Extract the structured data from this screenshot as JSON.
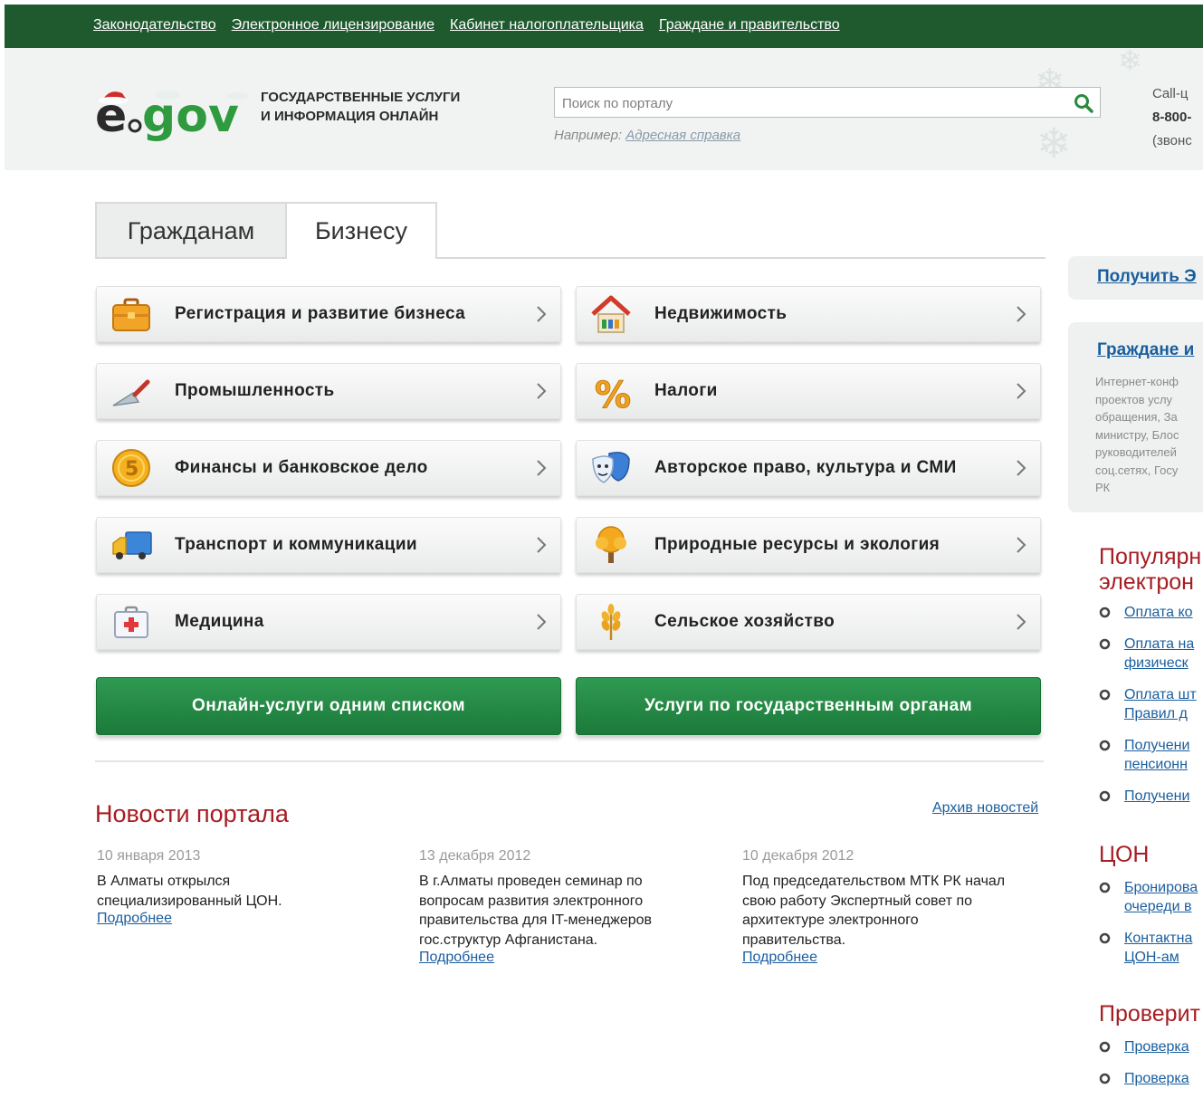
{
  "topnav": {
    "links": [
      "Законодательство",
      "Электронное лицензирование",
      "Кабинет налогоплательщика",
      "Граждане и правительство"
    ]
  },
  "header": {
    "logo_text": "egov",
    "tagline_line1": "ГОСУДАРСТВЕННЫЕ УСЛУГИ",
    "tagline_line2": "И ИНФОРМАЦИЯ ОНЛАЙН",
    "search_placeholder": "Поиск по порталу",
    "example_prefix": "Например:",
    "example_link": "Адресная справка",
    "callcenter_label": "Call-ц",
    "callcenter_phone": "8-800-",
    "callcenter_note": "(звонс"
  },
  "tabs": [
    "Гражданам",
    "Бизнесу"
  ],
  "categories": [
    {
      "label": "Регистрация и развитие бизнеса",
      "icon": "briefcase-icon"
    },
    {
      "label": "Недвижимость",
      "icon": "house-icon"
    },
    {
      "label": "Промышленность",
      "icon": "trowel-icon"
    },
    {
      "label": "Налоги",
      "icon": "percent-icon"
    },
    {
      "label": "Финансы и банковское дело",
      "icon": "coin-icon"
    },
    {
      "label": "Авторское право, культура и СМИ",
      "icon": "theater-masks-icon"
    },
    {
      "label": "Транспорт и коммуникации",
      "icon": "truck-icon"
    },
    {
      "label": "Природные ресурсы и экология",
      "icon": "tree-icon"
    },
    {
      "label": "Медицина",
      "icon": "first-aid-kit-icon"
    },
    {
      "label": "Сельское хозяйство",
      "icon": "wheat-icon"
    }
  ],
  "buttons": {
    "online_list": "Онлайн-услуги одним списком",
    "by_agencies": "Услуги по государственным органам"
  },
  "news": {
    "title": "Новости портала",
    "archive": "Архив новостей",
    "more": "Подробнее",
    "items": [
      {
        "date": "10 января 2013",
        "lines": [
          "В Алматы открылся",
          "специализированный ЦОН."
        ]
      },
      {
        "date": "13 декабря 2012",
        "lines": [
          "В г.Алматы проведен семинар по",
          "вопросам развития электронного",
          "правительства для IT-менеджеров",
          "гос.структур Афганистана."
        ]
      },
      {
        "date": "10 декабря 2012",
        "lines": [
          "Под председательством МТК РК начал",
          "свою работу Экспертный совет по",
          "архитектуре электронного",
          "правительства."
        ]
      }
    ]
  },
  "sidebar": {
    "promo_link": "Получить Э",
    "gov_title": "Граждане и",
    "gov_desc_lines": [
      "Интернет-конф",
      "проектов услу",
      "обращения, За",
      "министру, Блос",
      "руководителей",
      "соц.сетях, Госу",
      "РК"
    ],
    "popular_title_1": "Популярн",
    "popular_title_2": "электрон",
    "popular_items": [
      [
        "Оплата ко"
      ],
      [
        "Оплата на",
        "физическ"
      ],
      [
        "Оплата шт",
        "Правил д"
      ],
      [
        "Получени",
        "пенсионн"
      ],
      [
        "Получени"
      ]
    ],
    "con_title": "ЦОН",
    "con_items": [
      [
        "Бронирова",
        "очереди в"
      ],
      [
        "Контактна",
        "ЦОН-ам"
      ]
    ],
    "check_title": "Проверит",
    "check_items": [
      [
        "Проверка"
      ],
      [
        "Проверка"
      ]
    ]
  },
  "colors": {
    "topbar": "#1f5a2e",
    "accent_green": "#1c7a3a",
    "title_red": "#a61d22",
    "link_blue": "#1a5e9e"
  }
}
